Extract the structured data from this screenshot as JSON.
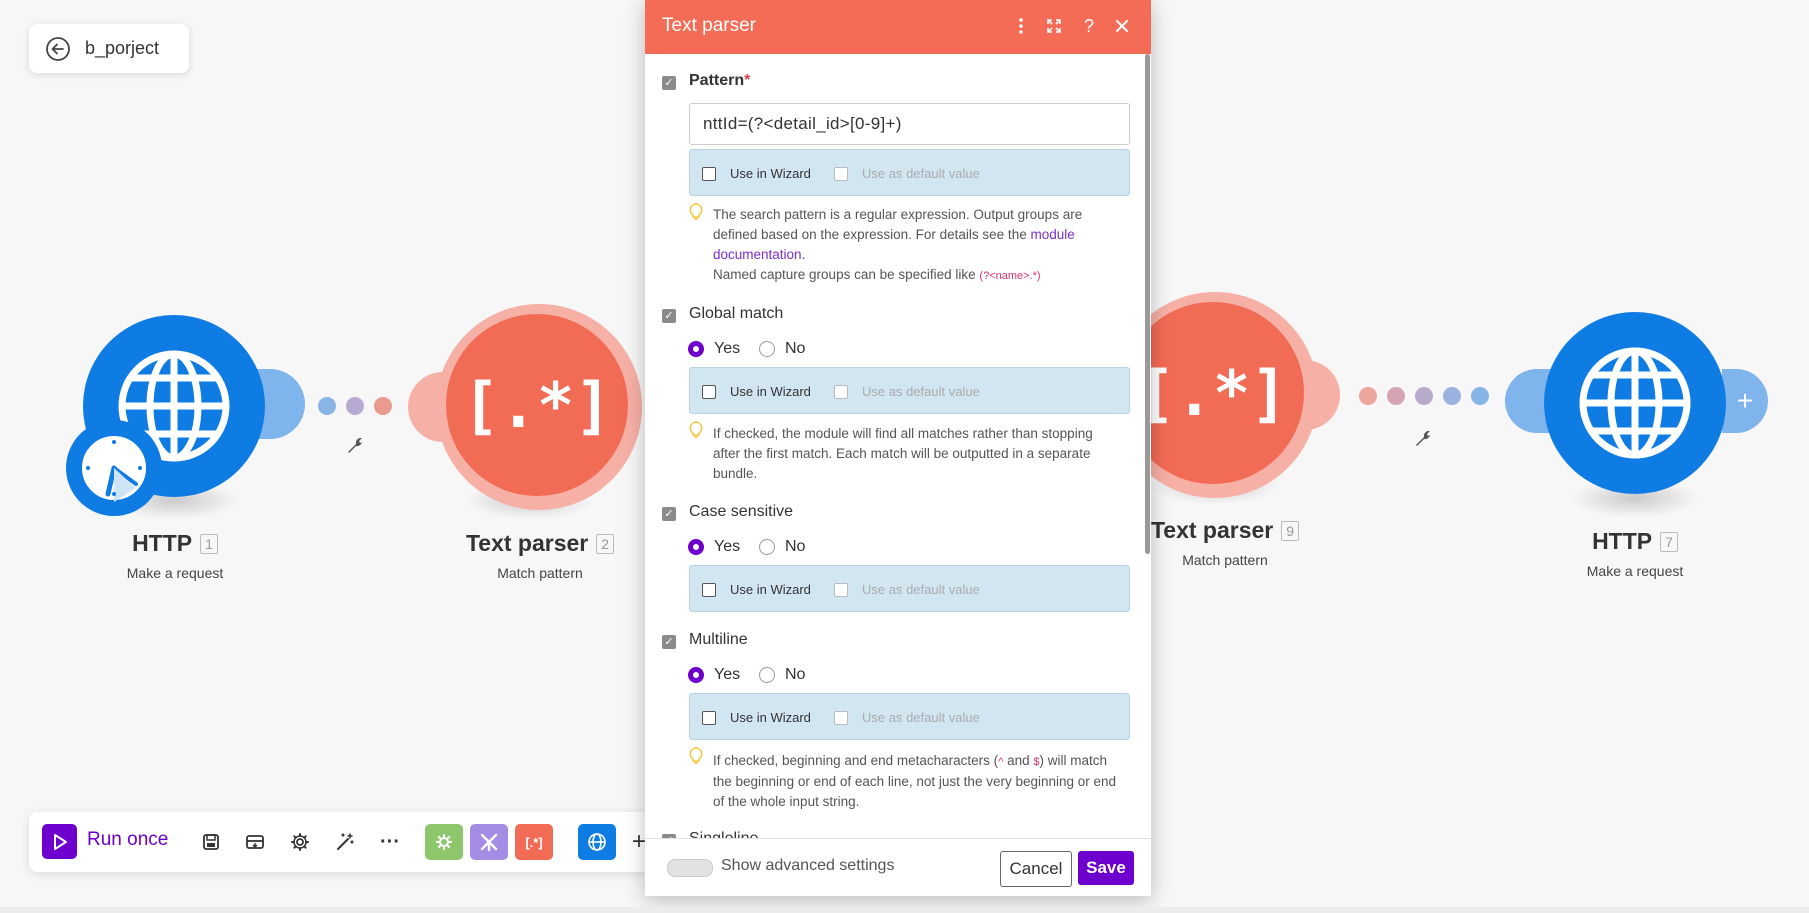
{
  "scenario": {
    "name": "b_porject"
  },
  "nodes": [
    {
      "id": "1",
      "title": "HTTP",
      "subtitle": "Make a request"
    },
    {
      "id": "2",
      "title": "Text parser",
      "subtitle": "Match pattern"
    },
    {
      "id": "9",
      "title": "Text parser",
      "subtitle": "Match pattern"
    },
    {
      "id": "7",
      "title": "HTTP",
      "subtitle": "Make a request"
    }
  ],
  "toolbar": {
    "run_label": "Run once"
  },
  "panel": {
    "title": "Text parser",
    "pattern": {
      "label": "Pattern",
      "required_mark": "*",
      "value": "nttId=(?<detail_id>[0-9]+)",
      "hint_text": "The search pattern is a regular expression. Output groups are defined based on the expression. For details see the",
      "hint_link": "module documentation",
      "hint_end": ".",
      "hint_line2": "Named capture groups can be specified like",
      "hint_code": "(?<name>.*)"
    },
    "wizard": {
      "use_in_wizard": "Use in Wizard",
      "use_default": "Use as default value"
    },
    "yes_label": "Yes",
    "no_label": "No",
    "global_match": {
      "label": "Global match",
      "hint": "If checked, the module will find all matches rather than stopping after the first match. Each match will be outputted in a separate bundle."
    },
    "case_sensitive": {
      "label": "Case sensitive"
    },
    "multiline": {
      "label": "Multiline",
      "hint_a": "If checked, beginning and end metacharacters (",
      "caret": "^",
      "hint_and": "and",
      "dollar": "$",
      "hint_b": ") will match the beginning or end of each line, not just the very beginning or end of the whole input string."
    },
    "singleline": {
      "label": "Singleline"
    },
    "footer": {
      "advanced": "Show advanced settings",
      "cancel": "Cancel",
      "save": "Save"
    }
  },
  "colors": {
    "brand_purple": "#6d00cc",
    "text_parser": "#f26b55",
    "http": "#0f7ce4"
  }
}
